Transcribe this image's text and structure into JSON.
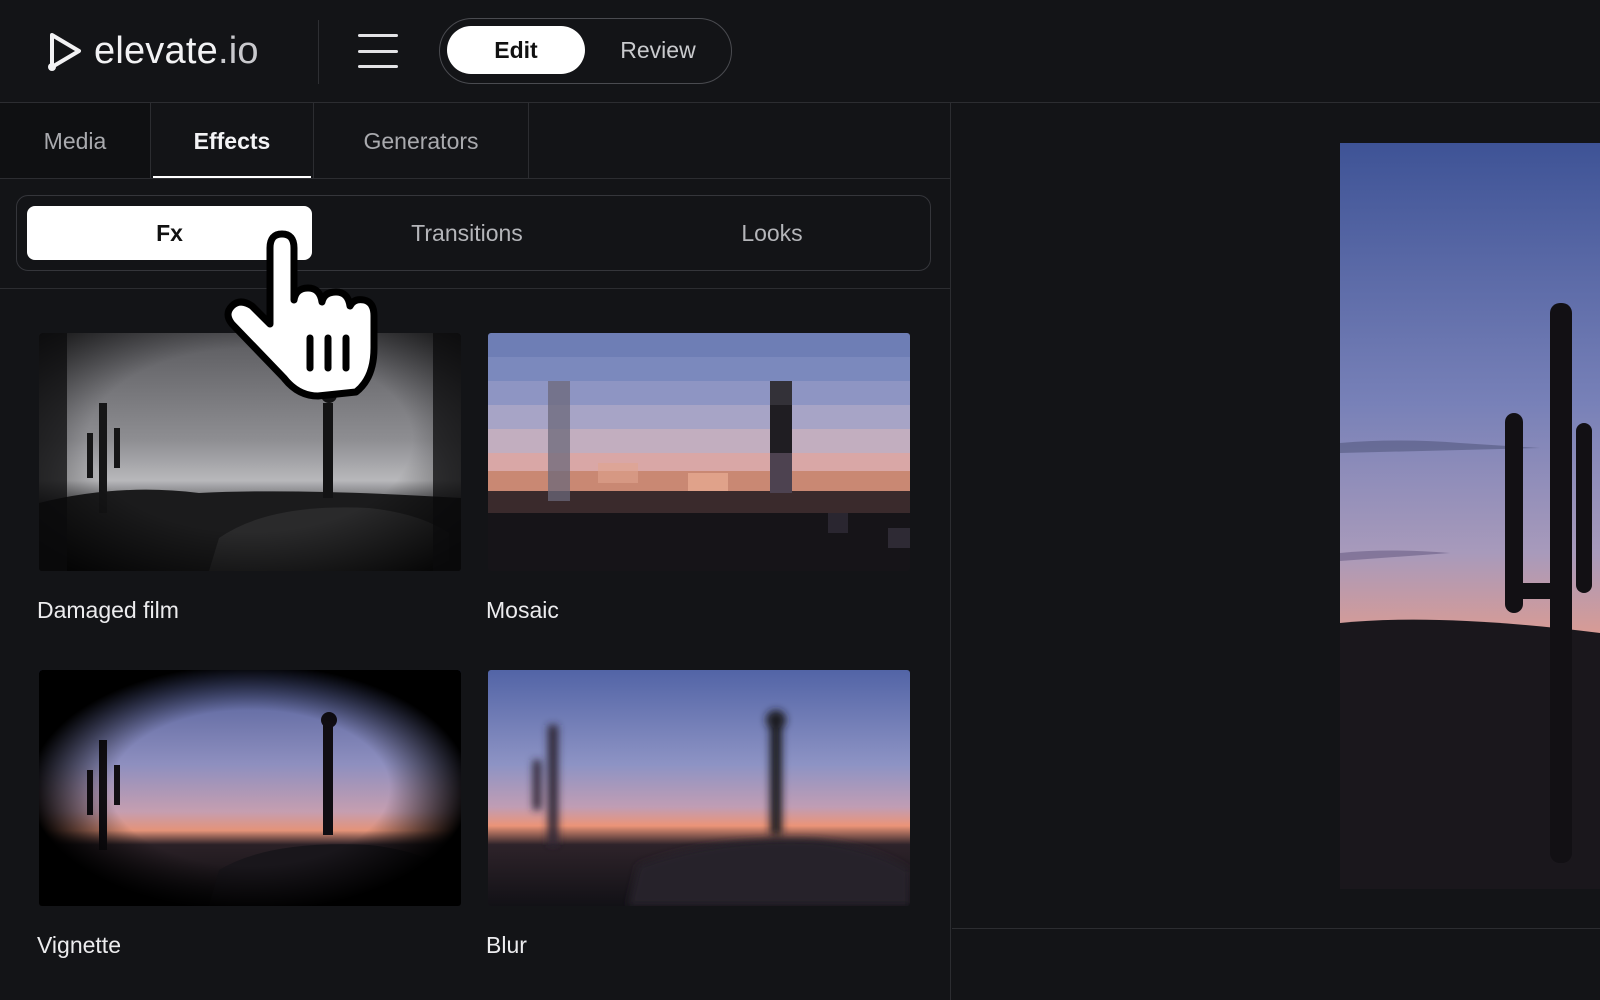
{
  "app": {
    "logo_name": "elevate",
    "logo_tld": ".io"
  },
  "header": {
    "modes": {
      "edit": "Edit",
      "review": "Review"
    },
    "active_mode": "Edit"
  },
  "panel": {
    "tabs": {
      "media": "Media",
      "effects": "Effects",
      "generators": "Generators"
    },
    "active_tab": "Effects",
    "subtabs": {
      "fx": "Fx",
      "transitions": "Transitions",
      "looks": "Looks"
    },
    "active_subtab": "Fx",
    "effects": [
      {
        "label": "Damaged film"
      },
      {
        "label": "Mosaic"
      },
      {
        "label": "Vignette"
      },
      {
        "label": "Blur"
      }
    ]
  },
  "colors": {
    "background": "#131417",
    "border": "#2c2d31",
    "active": "#ffffff",
    "text_muted": "#a9aaae"
  },
  "icons": {
    "logo": "play-triangle-logo-icon",
    "menu": "hamburger-menu-icon",
    "pointer": "hand-pointer-cursor-icon"
  }
}
